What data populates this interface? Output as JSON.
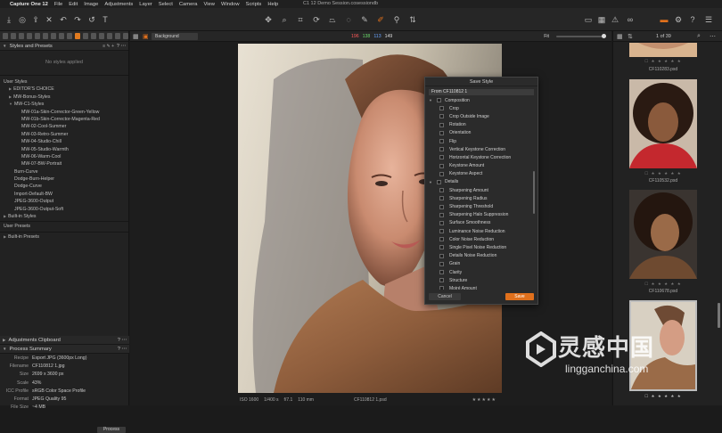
{
  "menubar": {
    "app": "Capture One 12",
    "items": [
      "File",
      "Edit",
      "Image",
      "Adjustments",
      "Layer",
      "Select",
      "Camera",
      "View",
      "Window",
      "Scripts",
      "Help"
    ],
    "document": "C1 12 Demo Session.cosessiondb"
  },
  "left": {
    "styles_title": "Styles and Presets",
    "no_styles": "No styles applied",
    "tree": [
      {
        "label": "User Styles",
        "depth": "root",
        "tri": ""
      },
      {
        "label": "EDITOR'S CHOICE",
        "depth": "d0",
        "tri": "▶"
      },
      {
        "label": "MW-Bonus-Styles",
        "depth": "d0",
        "tri": "▶"
      },
      {
        "label": "MW-C1-Styles",
        "depth": "d0",
        "tri": "▼"
      },
      {
        "label": "MW-01a-Skin-Corrector-Green-Yellow",
        "depth": "d2",
        "tri": ""
      },
      {
        "label": "MW-01b-Skin-Corrector-Magenta-Red",
        "depth": "d2",
        "tri": ""
      },
      {
        "label": "MW-02-Cool-Summer",
        "depth": "d2",
        "tri": ""
      },
      {
        "label": "MW-03-Retro-Summer",
        "depth": "d2",
        "tri": ""
      },
      {
        "label": "MW-04-Studio-Chill",
        "depth": "d2",
        "tri": ""
      },
      {
        "label": "MW-05-Studio-Warmth",
        "depth": "d2",
        "tri": ""
      },
      {
        "label": "MW-06-Warm-Cool",
        "depth": "d2",
        "tri": ""
      },
      {
        "label": "MW-07-BW-Portrait",
        "depth": "d2",
        "tri": ""
      },
      {
        "label": "Burn-Curve",
        "depth": "d1",
        "tri": ""
      },
      {
        "label": "Dodge-Burn-Helper",
        "depth": "d1",
        "tri": ""
      },
      {
        "label": "Dodge-Curve",
        "depth": "d1",
        "tri": ""
      },
      {
        "label": "Import-Default-BW",
        "depth": "d1",
        "tri": ""
      },
      {
        "label": "JPEG-3600-Output",
        "depth": "d1",
        "tri": ""
      },
      {
        "label": "JPEG-3600-Output-Soft",
        "depth": "d1",
        "tri": ""
      }
    ],
    "builtin_styles": "Built-in Styles",
    "user_presets": "User Presets",
    "builtin_presets": "Built-in Presets",
    "clipboard_title": "Adjustments Clipboard",
    "process_title": "Process Summary",
    "process": [
      {
        "k": "Recipe",
        "v": "Export JPG (3600px Long)"
      },
      {
        "k": "Filename",
        "v": "CF110812 1.jpg"
      },
      {
        "k": "Size",
        "v": "2699 x 3600 px"
      },
      {
        "k": "Scale",
        "v": "43%"
      },
      {
        "k": "ICC Profile",
        "v": "sRGB Color Space Profile"
      },
      {
        "k": "Format",
        "v": "JPEG Quality 95"
      },
      {
        "k": "File Size",
        "v": "~4 MB"
      }
    ],
    "process_button": "Process"
  },
  "viewer": {
    "preset": "Background",
    "rgb": {
      "r": "196",
      "g": "138",
      "b": "113",
      "l": "149"
    },
    "fit": "Fit",
    "info": {
      "iso": "ISO 1600",
      "shutter": "1/400 s",
      "aperture": "f/7.1",
      "focal": "110 mm",
      "filename": "CF110812 1.psd",
      "stars": "★★★★★"
    }
  },
  "dialog": {
    "title": "Save Style",
    "from": "From CF110812 1",
    "items": [
      {
        "label": "Composition",
        "group": true
      },
      {
        "label": "Crop",
        "group": false
      },
      {
        "label": "Crop Outside Image",
        "group": false
      },
      {
        "label": "Rotation",
        "group": false
      },
      {
        "label": "Orientation",
        "group": false
      },
      {
        "label": "Flip",
        "group": false
      },
      {
        "label": "Vertical Keystone Correction",
        "group": false
      },
      {
        "label": "Horizontal Keystone Correction",
        "group": false
      },
      {
        "label": "Keystone Amount",
        "group": false
      },
      {
        "label": "Keystone Aspect",
        "group": false
      },
      {
        "label": "Details",
        "group": true
      },
      {
        "label": "Sharpening Amount",
        "group": false
      },
      {
        "label": "Sharpening Radius",
        "group": false
      },
      {
        "label": "Sharpening Threshold",
        "group": false
      },
      {
        "label": "Sharpening Halo Suppression",
        "group": false
      },
      {
        "label": "Surface Smoothness",
        "group": false
      },
      {
        "label": "Luminance Noise Reduction",
        "group": false
      },
      {
        "label": "Color Noise Reduction",
        "group": false
      },
      {
        "label": "Single Pixel Noise Reduction",
        "group": false
      },
      {
        "label": "Details Noise Reduction",
        "group": false
      },
      {
        "label": "Grain",
        "group": false
      },
      {
        "label": "Clarity",
        "group": false
      },
      {
        "label": "Structure",
        "group": false
      },
      {
        "label": "Moiré Amount",
        "group": false
      }
    ],
    "cancel": "Cancel",
    "save": "Save"
  },
  "browser": {
    "count": "1 of 39",
    "thumbs": [
      {
        "name": "CF110283.psd"
      },
      {
        "name": "CF110532.psd"
      },
      {
        "name": "CF110678.psd"
      },
      {
        "name": "CF110812 1.psd"
      }
    ]
  },
  "watermark": {
    "cn": "灵感中国",
    "en": "lingganchina.com"
  },
  "colors": {
    "accent": "#e0701c",
    "background": "#1b1b1b",
    "panel": "#222222"
  }
}
